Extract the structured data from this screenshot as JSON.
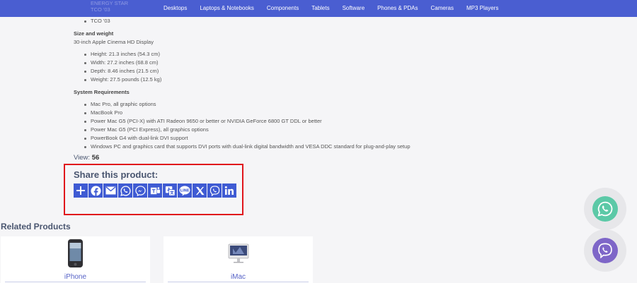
{
  "nav": {
    "faded_items": [
      "ENERGY STAR",
      "TCO '03"
    ],
    "items": [
      "Desktops",
      "Laptops & Notebooks",
      "Components",
      "Tablets",
      "Software",
      "Phones & PDAs",
      "Cameras",
      "MP3 Players"
    ]
  },
  "specs": {
    "tco": "TCO '03",
    "size_heading": "Size and weight",
    "size_sub": "30-inch Apple Cinema HD Display",
    "size_items": [
      "Height: 21.3 inches (54.3 cm)",
      "Width: 27.2 inches (68.8 cm)",
      "Depth: 8.46 inches (21.5 cm)",
      "Weight: 27.5 pounds (12.5 kg)"
    ],
    "req_heading": "System Requirements",
    "req_items": [
      "Mac Pro, all graphic options",
      "MacBook Pro",
      "Power Mac G5 (PCI-X) with ATI Radeon 9650 or better or NVIDIA GeForce 6800 GT DDL or better",
      "Power Mac G5 (PCI Express), all graphics options",
      "PowerBook G4 with dual-link DVI support",
      "Windows PC and graphics card that supports DVI ports with dual-link digital bandwidth and VESA DDC standard for plug-and-play setup"
    ]
  },
  "view": {
    "label": "View:",
    "count": "56"
  },
  "share": {
    "title": "Share this product:",
    "buttons": [
      "add-icon",
      "facebook-icon",
      "email-icon",
      "whatsapp-icon",
      "messenger-icon",
      "teams-icon",
      "translate-icon",
      "line-icon",
      "x-icon",
      "viber-icon",
      "linkedin-icon"
    ]
  },
  "related": {
    "title": "Related Products",
    "products": [
      "iPhone",
      "iMac"
    ]
  },
  "floating": [
    "whatsapp-icon",
    "viber-icon"
  ],
  "colors": {
    "nav": "#4a5ed1",
    "share_button": "#3f5bd3",
    "highlight_border": "#e0151b",
    "whatsapp": "#5cc9a7",
    "viber": "#7e66c8"
  }
}
